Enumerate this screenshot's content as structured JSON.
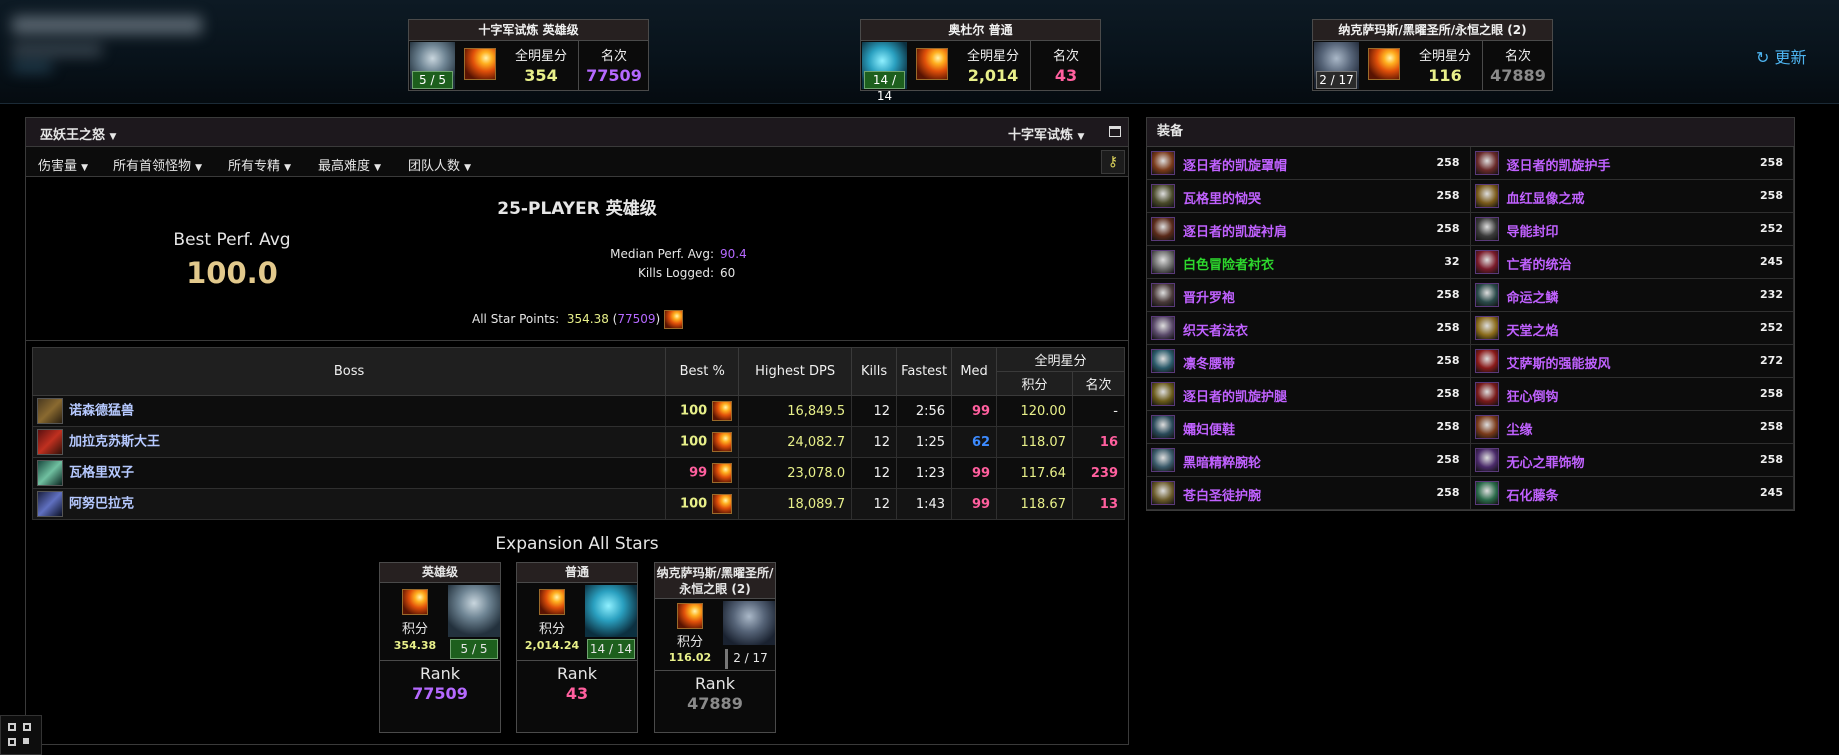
{
  "summaries": [
    {
      "title": "十字军试炼 英雄级",
      "progress": "5 / 5",
      "stars_label": "全明星分",
      "stars": "354",
      "rank_label": "名次",
      "rank": "77509",
      "rank_color": "purple"
    },
    {
      "title": "奥杜尔 普通",
      "progress": "14 / 14",
      "stars_label": "全明星分",
      "stars": "2,014",
      "rank_label": "名次",
      "rank": "43",
      "rank_color": "pink"
    },
    {
      "title": "纳克萨玛斯/黑曜圣所/永恒之眼 (2)",
      "progress": "2 / 17",
      "stars_label": "全明星分",
      "stars": "116",
      "rank_label": "名次",
      "rank": "47889",
      "rank_color": "gray"
    }
  ],
  "refresh_label": "↻ 更新",
  "left": {
    "title": "巫妖王之怒",
    "zone": "十字军试炼",
    "filters": [
      "伤害量",
      "所有首领怪物",
      "所有专精",
      "最高难度",
      "团队人数"
    ],
    "stats_title": "25-PLAYER 英雄级",
    "best_perf_label": "Best Perf. Avg",
    "best_perf_value": "100.0",
    "median_label": "Median Perf. Avg:",
    "median_value": "90.4",
    "kills_label": "Kills Logged:",
    "kills_value": "60",
    "all_star_label": "All Star Points:",
    "all_star_value": "354.38",
    "all_star_rank": "77509"
  },
  "table": {
    "headers": {
      "boss": "Boss",
      "best": "Best %",
      "dps": "Highest DPS",
      "kills": "Kills",
      "fastest": "Fastest",
      "med": "Med",
      "stars": "全明星分",
      "points": "积分",
      "rank": "名次"
    },
    "rows": [
      {
        "boss": "诺森德猛兽",
        "best": "100",
        "dps": "16,849.5",
        "kills": "12",
        "fastest": "2:56",
        "med": "99",
        "points": "120.00",
        "rank": "-"
      },
      {
        "boss": "加拉克苏斯大王",
        "best": "100",
        "dps": "24,082.7",
        "kills": "12",
        "fastest": "1:25",
        "med": "62",
        "points": "118.07",
        "rank": "16"
      },
      {
        "boss": "瓦格里双子",
        "best": "99",
        "dps": "23,078.0",
        "kills": "12",
        "fastest": "1:23",
        "med": "99",
        "points": "117.64",
        "rank": "239"
      },
      {
        "boss": "阿努巴拉克",
        "best": "100",
        "dps": "18,089.7",
        "kills": "12",
        "fastest": "1:43",
        "med": "99",
        "points": "118.67",
        "rank": "13"
      }
    ]
  },
  "expansion": {
    "title": "Expansion All Stars",
    "cards": [
      {
        "title": "英雄级",
        "points_label": "积分",
        "points": "354.38",
        "progress": "5 / 5",
        "rank_label": "Rank",
        "rank": "77509"
      },
      {
        "title": "普通",
        "points_label": "积分",
        "points": "2,014.24",
        "progress": "14 / 14",
        "rank_label": "Rank",
        "rank": "43"
      },
      {
        "title": "纳克萨玛斯/黑曜圣所/永恒之眼 (2)",
        "points_label": "积分",
        "points": "116.02",
        "progress": "2 / 17",
        "rank_label": "Rank",
        "rank": "47889"
      }
    ]
  },
  "gear": {
    "title": "装备",
    "items": [
      {
        "name": "逐日者的凯旋罩帽",
        "ilvl": "258"
      },
      {
        "name": "逐日者的凯旋护手",
        "ilvl": "258"
      },
      {
        "name": "瓦格里的恸哭",
        "ilvl": "258"
      },
      {
        "name": "血红显像之戒",
        "ilvl": "258"
      },
      {
        "name": "逐日者的凯旋衬肩",
        "ilvl": "258"
      },
      {
        "name": "导能封印",
        "ilvl": "252"
      },
      {
        "name": "白色冒险者衬衣",
        "ilvl": "32"
      },
      {
        "name": "亡者的统治",
        "ilvl": "245"
      },
      {
        "name": "晋升罗袍",
        "ilvl": "258"
      },
      {
        "name": "命运之鳞",
        "ilvl": "232"
      },
      {
        "name": "织天者法衣",
        "ilvl": "258"
      },
      {
        "name": "天堂之焰",
        "ilvl": "252"
      },
      {
        "name": "凛冬腰带",
        "ilvl": "258"
      },
      {
        "name": "艾萨斯的强能披风",
        "ilvl": "272"
      },
      {
        "name": "逐日者的凯旋护腿",
        "ilvl": "258"
      },
      {
        "name": "狂心倒钩",
        "ilvl": "258"
      },
      {
        "name": "孀妇便鞋",
        "ilvl": "258"
      },
      {
        "name": "尘缘",
        "ilvl": "258"
      },
      {
        "name": "黑暗精粹腕轮",
        "ilvl": "258"
      },
      {
        "name": "无心之罪饰物",
        "ilvl": "258"
      },
      {
        "name": "苍白圣徒护腕",
        "ilvl": "258"
      },
      {
        "name": "石化藤条",
        "ilvl": "245"
      }
    ]
  },
  "colors": {
    "yellow": "#e8f08a",
    "purple": "#b569ff",
    "pink": "#ff5f9e",
    "gray": "#8a8a8a",
    "blue": "#3d8bff",
    "gear_epic": "#c061ff",
    "gear_uncommon": "#2dd82d",
    "gold": "#e2c98c"
  }
}
